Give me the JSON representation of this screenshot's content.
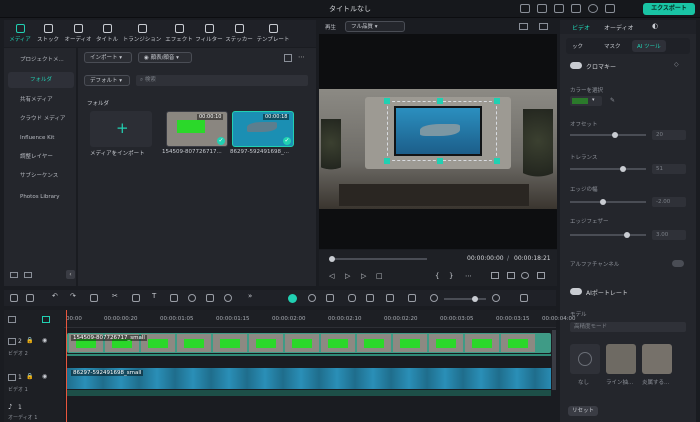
{
  "window": {
    "title": "タイトルなし",
    "export_label": "エクスポート"
  },
  "media_toolbar": [
    {
      "label": "メディア",
      "icon": "media-icon",
      "active": true
    },
    {
      "label": "ストック",
      "icon": "stock-icon"
    },
    {
      "label": "オーディオ",
      "icon": "music-icon"
    },
    {
      "label": "タイトル",
      "icon": "title-icon"
    },
    {
      "label": "トランジション",
      "icon": "transition-icon"
    },
    {
      "label": "エフェクト",
      "icon": "effect-icon"
    },
    {
      "label": "フィルター",
      "icon": "filter-icon"
    },
    {
      "label": "ステッカー",
      "icon": "sticker-icon"
    },
    {
      "label": "テンプレート",
      "icon": "template-icon"
    }
  ],
  "sidebar": {
    "items": [
      "プロジェクトメ...",
      "フォルダ",
      "共有メディア",
      "クラウド メディア",
      "Influence Kit",
      "調整レイヤー",
      "サブシーケンス",
      "Photos Library"
    ]
  },
  "media": {
    "import_label": "インポート",
    "sort_label": "顔表/顔音",
    "sort_default": "デフォルト",
    "search_placeholder": "検索",
    "folder_label": "フォルダ",
    "items": [
      {
        "label": "メディアをインポート"
      },
      {
        "label": "154509-807726717...",
        "duration": "00:00:10"
      },
      {
        "label": "86297-592491698_...",
        "duration": "00:00:18"
      }
    ]
  },
  "preview": {
    "label": "再生",
    "quality": "フル品質",
    "current_time": "00:00:00:00",
    "separator": "/",
    "total_time": "00:00:18:21"
  },
  "inspector": {
    "tabs": [
      "ビデオ",
      "オーディオ"
    ],
    "subtabs": [
      "ック",
      "マスク",
      "AI ツール"
    ],
    "chroma_label": "クロマキー",
    "color_label": "カラーを選択",
    "color_value": "#2b7a2b",
    "offset_label": "オフセット",
    "offset_value": "20",
    "tolerance_label": "トレランス",
    "tolerance_value": "51",
    "edge_width_label": "エッジの幅",
    "edge_width_value": "-2.00",
    "edge_feather_label": "エッジフェザー",
    "edge_feather_value": "3.00",
    "alpha_label": "アルファチャンネル",
    "ai_portrait_label": "AIポートレート",
    "model_label": "モデル",
    "model_value": "高精度モード",
    "preset_none": "なし",
    "preset1": "ライン抽...",
    "preset2": "炎属する...",
    "reset_label": "リセット"
  },
  "ruler": [
    "00:00",
    "00:00:00:20",
    "00:00:01:05",
    "00:00:01:15",
    "00:00:02:00",
    "00:00:02:10",
    "00:00:02:20",
    "00:00:03:05",
    "00:00:03:15",
    "00:00:04:00"
  ],
  "tracks": [
    {
      "label": "ビデオ 2",
      "num": "2",
      "clip": "154509-807726717_small"
    },
    {
      "label": "ビデオ 1",
      "num": "1",
      "clip": "86297-592491698_small"
    },
    {
      "label": "オーディオ 1",
      "num": "1"
    }
  ],
  "colors": {
    "accent": "#21d0b2",
    "chroma_green": "#2bd82a"
  }
}
